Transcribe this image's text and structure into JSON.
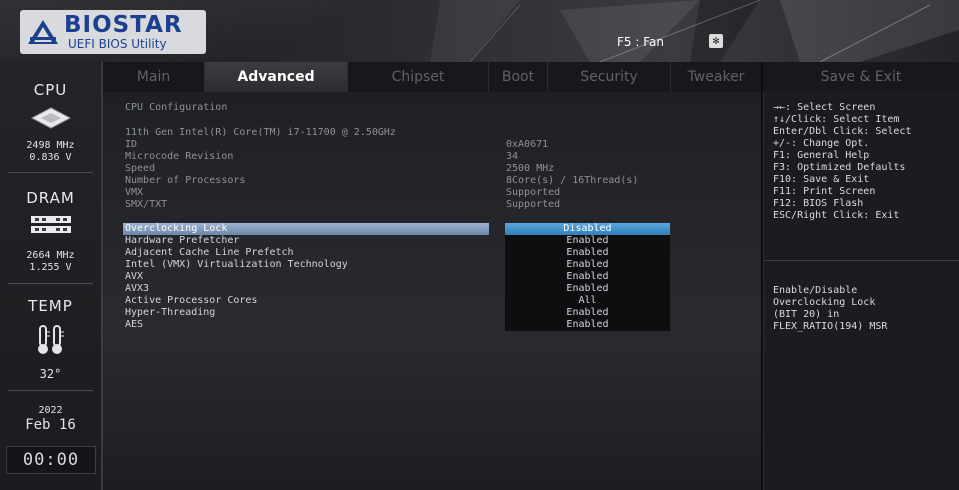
{
  "header": {
    "brand": "BIOSTAR",
    "subtitle": "UEFI BIOS Utility",
    "fan_hint": "F5 : Fan",
    "fan_icon": "fan-icon"
  },
  "sidebar": {
    "cpu_title": "CPU",
    "cpu_freq": "2498 MHz",
    "cpu_volt": "0.836 V",
    "dram_title": "DRAM",
    "dram_freq": "2664 MHz",
    "dram_volt": "1.255 V",
    "temp_title": "TEMP",
    "temp_value": "32°",
    "year": "2022",
    "date": "Feb 16",
    "clock": "00:00"
  },
  "tabs": [
    {
      "label": "Main"
    },
    {
      "label": "Advanced",
      "active": true
    },
    {
      "label": "Chipset"
    },
    {
      "label": "Boot"
    },
    {
      "label": "Security"
    },
    {
      "label": "Tweaker"
    }
  ],
  "save_exit_tab": "Save & Exit",
  "main": {
    "section_title": "CPU Configuration",
    "cpu_name": "11th Gen Intel(R) Core(TM) i7-11700 @ 2.50GHz",
    "info": [
      {
        "label": "ID",
        "value": "0xA0671"
      },
      {
        "label": "Microcode Revision",
        "value": "34"
      },
      {
        "label": "Speed",
        "value": "2500 MHz"
      },
      {
        "label": "Number of Processors",
        "value": "8Core(s) / 16Thread(s)"
      },
      {
        "label": "VMX",
        "value": "Supported"
      },
      {
        "label": "SMX/TXT",
        "value": "Supported"
      }
    ],
    "options": [
      {
        "label": "Overclocking Lock",
        "value": "Disabled",
        "selected": true
      },
      {
        "label": "Hardware Prefetcher",
        "value": "Enabled"
      },
      {
        "label": "Adjacent Cache Line Prefetch",
        "value": "Enabled"
      },
      {
        "label": "Intel (VMX) Virtualization Technology",
        "value": "Enabled"
      },
      {
        "label": "AVX",
        "value": "Enabled"
      },
      {
        "label": "AVX3",
        "value": "Enabled"
      },
      {
        "label": "Active Processor Cores",
        "value": "All"
      },
      {
        "label": "Hyper-Threading",
        "value": "Enabled"
      },
      {
        "label": "AES",
        "value": "Enabled"
      }
    ]
  },
  "help": {
    "keys": [
      "→←: Select Screen",
      "↑↓/Click: Select Item",
      "Enter/Dbl Click: Select",
      "+/-: Change Opt.",
      "F1: General Help",
      "F3: Optimized Defaults",
      "F10: Save & Exit",
      "F11: Print Screen",
      "F12: BIOS Flash",
      "ESC/Right Click: Exit"
    ],
    "description": [
      "Enable/Disable",
      "Overclocking Lock",
      "(BIT 20) in",
      "FLEX_RATIO(194) MSR"
    ]
  },
  "colors": {
    "accent": "#2f7fb8",
    "brand_blue": "#1d3f8f",
    "selected_row": "#6c87ad"
  }
}
